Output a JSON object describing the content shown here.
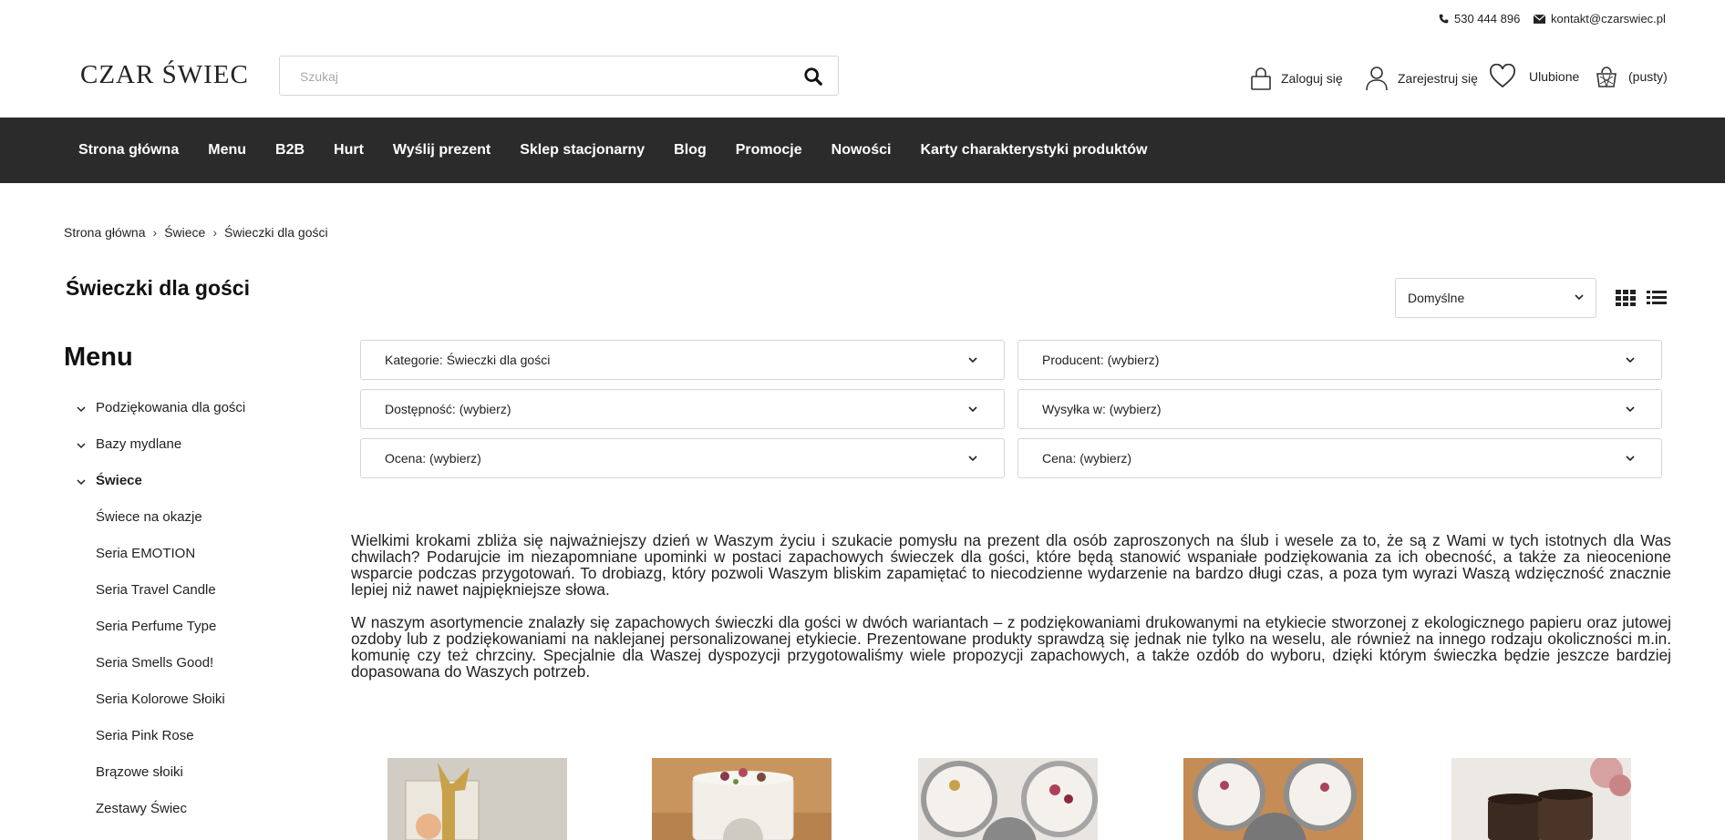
{
  "contact": {
    "phone": "530 444 896",
    "email": "kontakt@czarswiec.pl"
  },
  "header": {
    "logo": "CZAR ŚWIEC",
    "search_placeholder": "Szukaj",
    "login": "Zaloguj się",
    "register": "Zarejestruj się",
    "favorites": "Ulubione",
    "cart": "(pusty)"
  },
  "nav": {
    "items": [
      "Strona główna",
      "Menu",
      "B2B",
      "Hurt",
      "Wyślij prezent",
      "Sklep stacjonarny",
      "Blog",
      "Promocje",
      "Nowości",
      "Karty charakterystyki produktów"
    ]
  },
  "breadcrumb": [
    "Strona główna",
    "Świece",
    "Świeczki dla gości"
  ],
  "page_title": "Świeczki dla gości",
  "sort": {
    "selected": "Domyślne"
  },
  "sidebar": {
    "title": "Menu",
    "items": [
      "Podziękowania dla gości",
      "Bazy mydlane",
      "Świece",
      "Świece na okazje",
      "Seria EMOTION",
      "Seria Travel Candle",
      "Seria Perfume Type",
      "Seria Smells Good!",
      "Seria Kolorowe Słoiki",
      "Seria Pink Rose",
      "Brązowe słoiki",
      "Zestawy Świec"
    ]
  },
  "filters": [
    "Kategorie: Świeczki dla gości",
    "Producent: (wybierz)",
    "Dostępność: (wybierz)",
    "Wysyłka w: (wybierz)",
    "Ocena: (wybierz)",
    "Cena: (wybierz)"
  ],
  "description": {
    "p1": "Wielkimi krokami zbliża się najważniejszy dzień w Waszym życiu i szukacie pomysłu na prezent dla osób zaproszonych na ślub i wesele za to, że są z Wami w tych istotnych dla Was chwilach? Podarujcie im niezapomniane upominki w postaci zapachowych świeczek dla gości, które będą stanowić wspaniałe podziękowania za ich obecność, a także za nieocenione wsparcie podczas przygotowań. To drobiazg, który pozwoli Waszym bliskim zapamiętać to niecodzienne wydarzenie na bardzo długi czas, a poza tym wyrazi Waszą wdzięczność znacznie lepiej niż nawet najpiękniejsze słowa.",
    "p2": "W naszym asortymencie znalazły się zapachowych świeczki dla gości w dwóch wariantach – z podziękowaniami drukowanymi na etykiecie stworzonej z ekologicznego papieru oraz jutowej ozdoby lub z podziękowaniami na naklejanej personalizowanej etykiecie. Prezentowane produkty sprawdzą się jednak nie tylko na weselu, ale również na innego rodzaju okoliczności m.in. komunię czy też chrzciny. Specjalnie dla Waszej dyspozycji przygotowaliśmy wiele propozycji zapachowych, a także ozdób do wyboru, dzięki którym świeczka będzie jeszcze bardziej dopasowana do Waszych potrzeb."
  },
  "colors": {
    "nav_bg": "#2b2b2b",
    "border": "#d6d6d6"
  }
}
